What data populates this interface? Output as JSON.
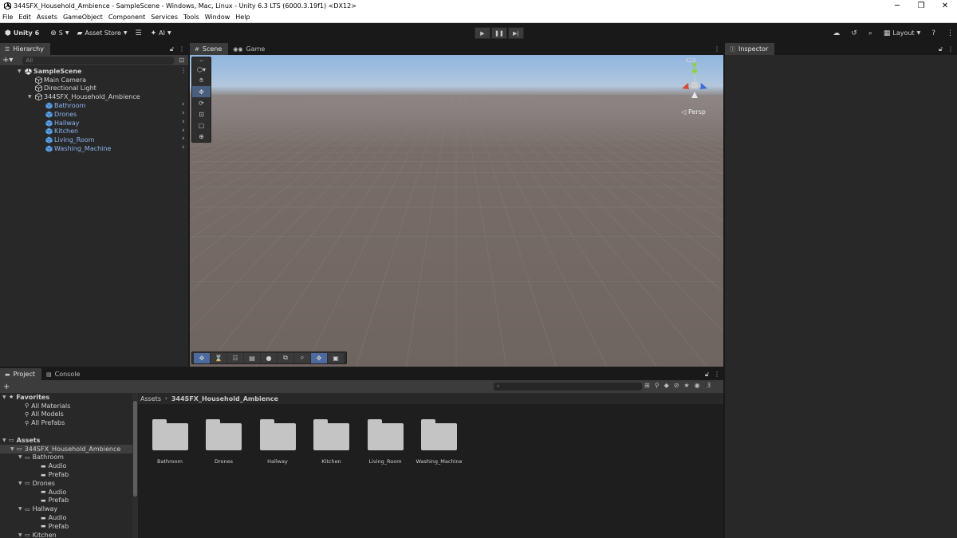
{
  "window": {
    "title": "344SFX_Household_Ambience - SampleScene - Windows, Mac, Linux - Unity 6.3 LTS (6000.3.19f1) <DX12>",
    "minimize": "─",
    "maximize": "❐",
    "close": "✕"
  },
  "menu": [
    "File",
    "Edit",
    "Assets",
    "GameObject",
    "Component",
    "Services",
    "Tools",
    "Window",
    "Help"
  ],
  "toolbar": {
    "unity_label": "Unity 6",
    "account_label": "S",
    "asset_store_label": "Asset Store",
    "ai_label": "AI",
    "layout_label": "Layout"
  },
  "hierarchy": {
    "tab_label": "Hierarchy",
    "search_placeholder": "All",
    "items": [
      {
        "label": "SampleScene",
        "indent": 0,
        "kind": "scene"
      },
      {
        "label": "Main Camera",
        "indent": 1,
        "kind": "object"
      },
      {
        "label": "Directional Light",
        "indent": 1,
        "kind": "object"
      },
      {
        "label": "344SFX_Household_Ambience",
        "indent": 1,
        "kind": "object"
      },
      {
        "label": "Bathroom",
        "indent": 2,
        "kind": "prefab"
      },
      {
        "label": "Drones",
        "indent": 2,
        "kind": "prefab"
      },
      {
        "label": "Hallway",
        "indent": 2,
        "kind": "prefab"
      },
      {
        "label": "Kitchen",
        "indent": 2,
        "kind": "prefab"
      },
      {
        "label": "Living_Room",
        "indent": 2,
        "kind": "prefab"
      },
      {
        "label": "Washing_Machine",
        "indent": 2,
        "kind": "prefab"
      }
    ]
  },
  "scene": {
    "tab_scene": "Scene",
    "tab_game": "Game",
    "projection_label": "◁ Persp"
  },
  "inspector": {
    "tab_label": "Inspector"
  },
  "project": {
    "tab_project": "Project",
    "tab_console": "Console",
    "hidden_count": "3",
    "tree": [
      {
        "label": "Favorites",
        "indent": 0,
        "kind": "star",
        "bold": true
      },
      {
        "label": "All Materials",
        "indent": 2,
        "kind": "search"
      },
      {
        "label": "All Models",
        "indent": 2,
        "kind": "search"
      },
      {
        "label": "All Prefabs",
        "indent": 2,
        "kind": "search"
      },
      {
        "label": "Assets",
        "indent": 0,
        "kind": "folder-open",
        "bold": true
      },
      {
        "label": "344SFX_Household_Ambience",
        "indent": 1,
        "kind": "folder-open",
        "selected": true
      },
      {
        "label": "Bathroom",
        "indent": 2,
        "kind": "folder-open"
      },
      {
        "label": "Audio",
        "indent": 4,
        "kind": "folder"
      },
      {
        "label": "Prefab",
        "indent": 4,
        "kind": "folder"
      },
      {
        "label": "Drones",
        "indent": 2,
        "kind": "folder-open"
      },
      {
        "label": "Audio",
        "indent": 4,
        "kind": "folder"
      },
      {
        "label": "Prefab",
        "indent": 4,
        "kind": "folder"
      },
      {
        "label": "Hallway",
        "indent": 2,
        "kind": "folder-open"
      },
      {
        "label": "Audio",
        "indent": 4,
        "kind": "folder"
      },
      {
        "label": "Prefab",
        "indent": 4,
        "kind": "folder"
      },
      {
        "label": "Kitchen",
        "indent": 2,
        "kind": "folder-open"
      }
    ],
    "breadcrumb": [
      "Assets",
      "344SFX_Household_Ambience"
    ],
    "folders": [
      "Bathroom",
      "Drones",
      "Hallway",
      "Kitchen",
      "Living_Room",
      "Washing_Machine"
    ]
  }
}
